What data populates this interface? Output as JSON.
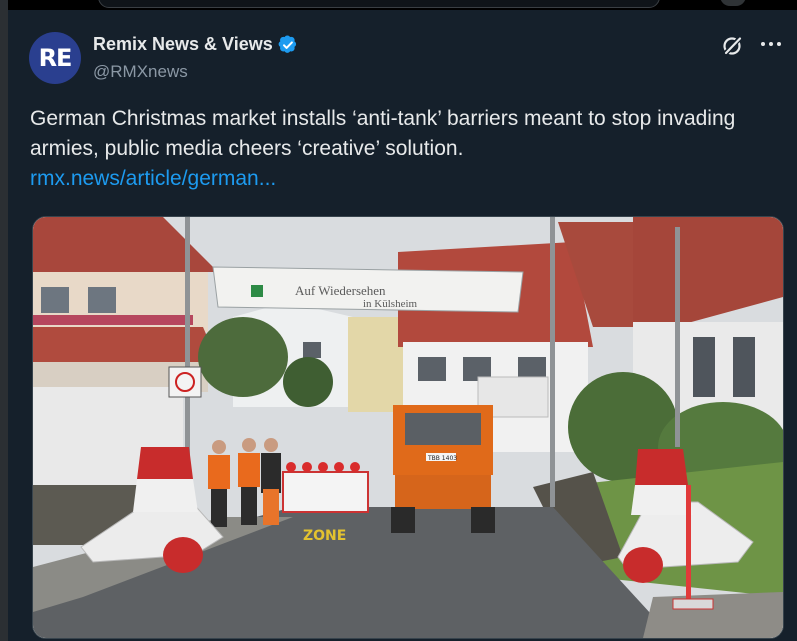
{
  "post": {
    "author": {
      "avatar_text": "RE",
      "display_name": "Remix News & Views",
      "handle": "@RMXnews"
    },
    "text": "German Christmas market installs ‘anti-tank’ barriers meant to stop invading armies, public media cheers ‘creative’ solution.",
    "link_text": "rmx.news/article/german..."
  },
  "media": {
    "banner_text_line1": "Auf Wiedersehen",
    "banner_text_line2": "in Külsheim",
    "truck_plate": "TBB 1403",
    "road_marking": "ZONE"
  },
  "icons": {
    "verified": "verified-badge-icon",
    "grok": "grok-icon",
    "more": "more-options-icon"
  },
  "colors": {
    "background": "#15202b",
    "link": "#1d9bf0",
    "verified": "#1d9bf0",
    "secondary_text": "#8b98a5"
  }
}
